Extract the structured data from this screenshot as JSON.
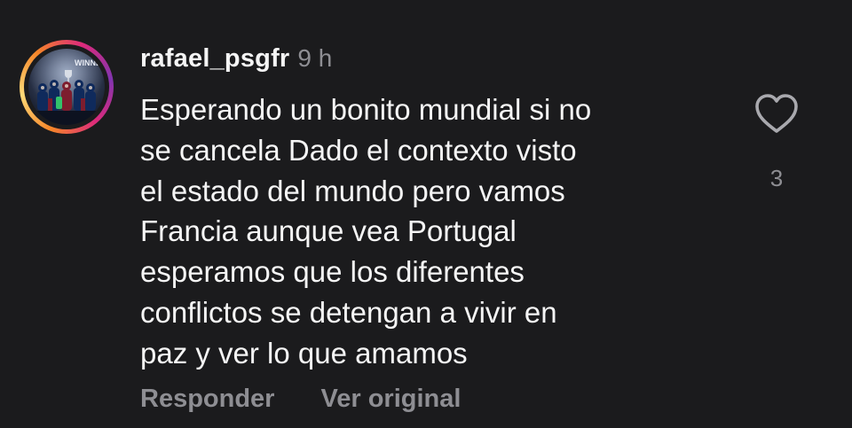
{
  "comment": {
    "username": "rafael_psgfr",
    "timestamp": "9 h",
    "avatar_banner_text": "WINNER",
    "text_lines": [
      "Esperando un bonito mundial si no",
      "se cancela Dado el contexto visto",
      "el estado del mundo pero vamos",
      "Francia aunque vea Portugal",
      "esperamos que los diferentes",
      "conflictos se detengan a vivir en",
      "paz y ver lo que amamos"
    ],
    "like_count": "3",
    "actions": {
      "reply_label": "Responder",
      "see_original_label": "Ver original"
    }
  },
  "colors": {
    "background": "#1b1b1d",
    "primary_text": "#f5f5f5",
    "secondary_text": "#8e8e93",
    "story_ring": [
      "#f58529",
      "#feda77",
      "#dd2a7b",
      "#8134af"
    ]
  },
  "icons": {
    "like": "heart-outline-icon"
  }
}
